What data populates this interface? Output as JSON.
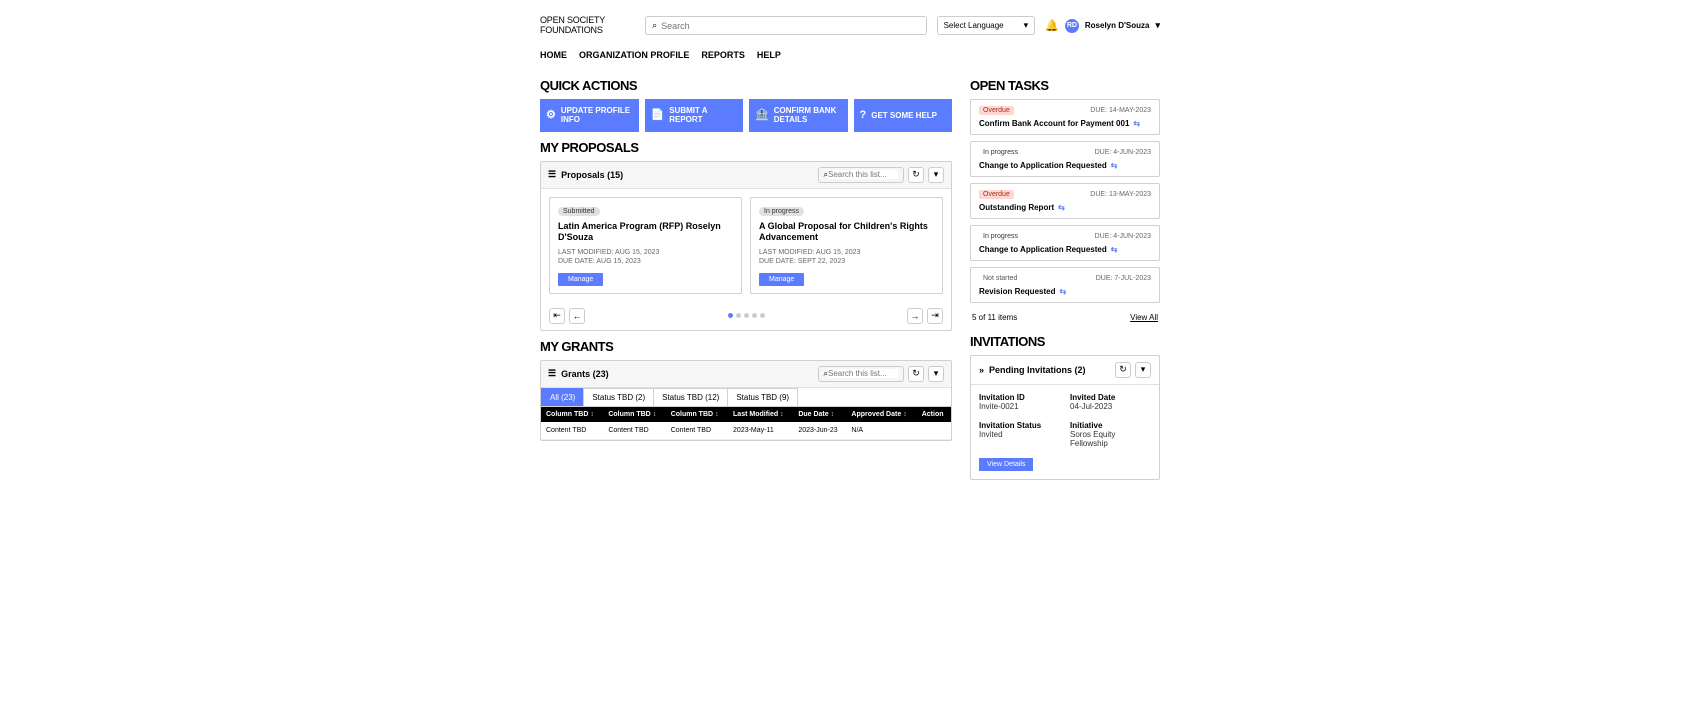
{
  "header": {
    "logo_line1": "OPEN SOCIETY",
    "logo_line2": "FOUNDATIONS",
    "search_placeholder": "Search",
    "language_label": "Select Language",
    "username": "Roselyn D'Souza"
  },
  "nav": {
    "home": "HOME",
    "org": "ORGANIZATION PROFILE",
    "reports": "REPORTS",
    "help": "HELP"
  },
  "quick_actions": {
    "heading": "QUICK ACTIONS",
    "update": "UPDATE PROFILE INFO",
    "submit": "SUBMIT A REPORT",
    "confirm": "CONFIRM BANK DETAILS",
    "help": "GET SOME HELP"
  },
  "proposals": {
    "heading": "MY PROPOSALS",
    "panel_title": "Proposals (15)",
    "search_placeholder": "Search this list...",
    "cards": [
      {
        "status": "Submitted",
        "title": "Latin America Program (RFP) Roselyn D'Souza",
        "last_modified": "LAST MODIFIED: AUG 15, 2023",
        "due": "DUE DATE: AUG 15, 2023",
        "button": "Manage"
      },
      {
        "status": "In progress",
        "title": "A Global Proposal for Children's Rights Advancement",
        "last_modified": "LAST MODIFIED: AUG 15, 2023",
        "due": "DUE DATE: SEPT 22, 2023",
        "button": "Manage"
      }
    ]
  },
  "grants": {
    "heading": "MY GRANTS",
    "panel_title": "Grants (23)",
    "search_placeholder": "Search this list...",
    "tabs": [
      "All (23)",
      "Status TBD (2)",
      "Status TBD (12)",
      "Status TBD (9)"
    ],
    "columns": [
      "Column TBD",
      "Column TBD",
      "Column TBD",
      "Last Modified",
      "Due Date",
      "Approved Date",
      "Action"
    ],
    "row": [
      "Content TBD",
      "Content TBD",
      "Content TBD",
      "2023-May-11",
      "2023-Jun-23",
      "N/A",
      ""
    ]
  },
  "open_tasks": {
    "heading": "OPEN TASKS",
    "items": [
      {
        "status": "Overdue",
        "status_class": "st-overdue",
        "due": "DUE: 14-MAY-2023",
        "title": "Confirm Bank Account for Payment 001"
      },
      {
        "status": "In progress",
        "status_class": "st-inprogress",
        "due": "DUE: 4-JUN-2023",
        "title": "Change to Application Requested"
      },
      {
        "status": "Overdue",
        "status_class": "st-overdue",
        "due": "DUE: 13-MAY-2023",
        "title": "Outstanding Report"
      },
      {
        "status": "In progress",
        "status_class": "st-inprogress",
        "due": "DUE: 4-JUN-2023",
        "title": "Change to Application Requested"
      },
      {
        "status": "Not started",
        "status_class": "st-notstarted",
        "due": "DUE: 7-JUL-2023",
        "title": "Revision Requested"
      }
    ],
    "count_text": "5 of 11 items",
    "view_all": "View All"
  },
  "invitations": {
    "heading": "INVITATIONS",
    "panel_title": "Pending Invitations (2)",
    "labels": {
      "inv_id": "Invitation ID",
      "inv_date": "Invited Date",
      "inv_status": "Invitation Status",
      "initiative": "Initiative"
    },
    "values": {
      "inv_id": "Invite-0021",
      "inv_date": "04-Jul-2023",
      "inv_status": "Invited",
      "initiative": "Soros Equity Fellowship"
    },
    "button": "View Details"
  }
}
